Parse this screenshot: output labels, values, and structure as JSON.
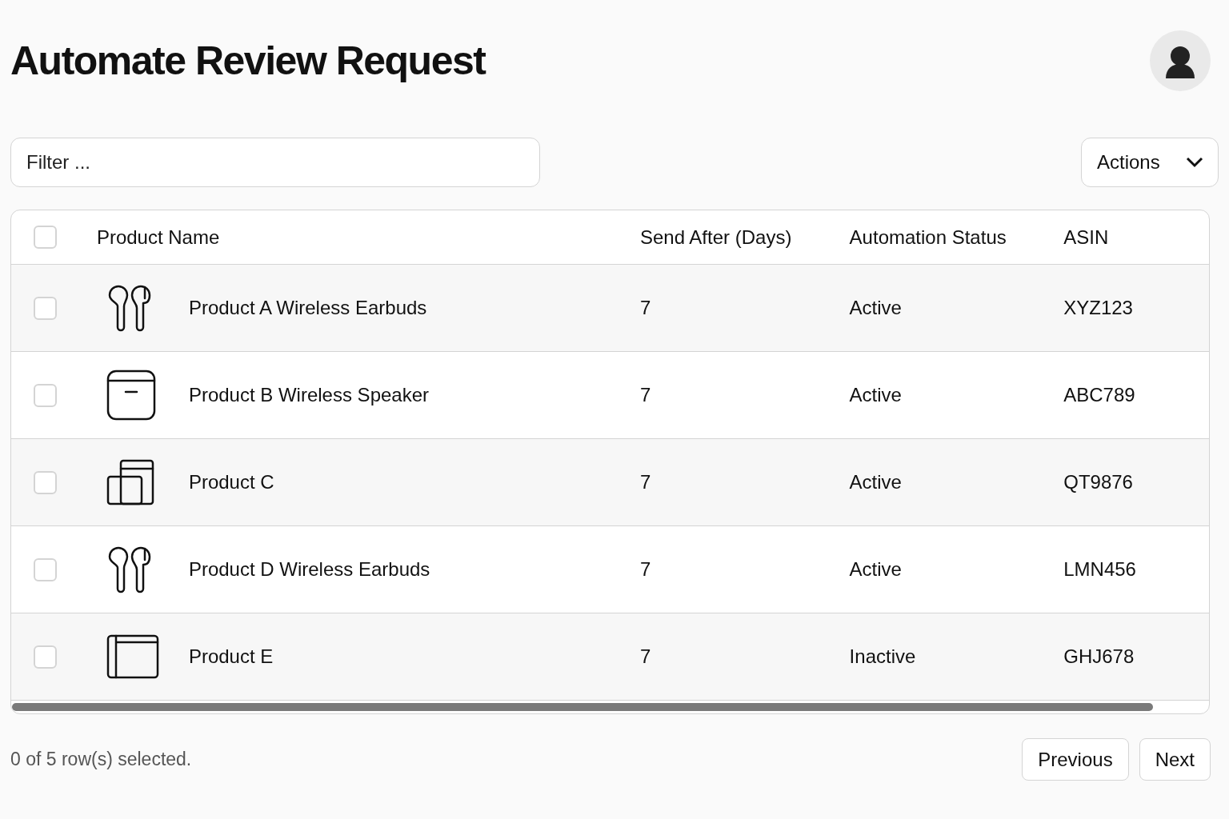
{
  "title": "Automate Review Request",
  "filter": {
    "placeholder": "Filter ..."
  },
  "actions": {
    "label": "Actions"
  },
  "table": {
    "select_all": {
      "checked": false
    },
    "columns": [
      "Product Name",
      "Send After (Days)",
      "Automation Status",
      "ASIN"
    ],
    "rows": [
      {
        "kind": "earbuds",
        "name": "Product A Wireless Earbuds",
        "send_after": "7",
        "status": "Active",
        "asin": "XYZ123",
        "selected": false
      },
      {
        "kind": "speaker",
        "name": "Product B Wireless Speaker",
        "send_after": "7",
        "status": "Active",
        "asin": "ABC789",
        "selected": false
      },
      {
        "kind": "devices",
        "name": "Product C",
        "send_after": "7",
        "status": "Active",
        "asin": "QT9876",
        "selected": false
      },
      {
        "kind": "earbuds",
        "name": "Product D Wireless Earbuds",
        "send_after": "7",
        "status": "Active",
        "asin": "LMN456",
        "selected": false
      },
      {
        "kind": "folio",
        "name": "Product E",
        "send_after": "7",
        "status": "Inactive",
        "asin": "GHJ678",
        "selected": false
      }
    ]
  },
  "footer": {
    "selection": "0 of 5 row(s) selected.",
    "buttons": [
      "Previous",
      "Next"
    ]
  }
}
